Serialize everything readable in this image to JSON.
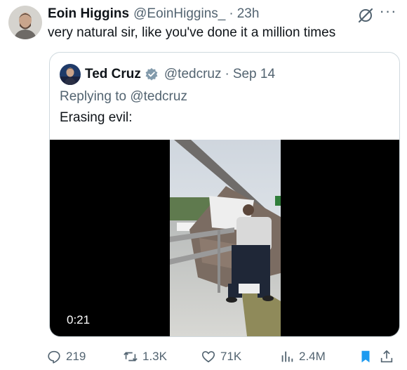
{
  "tweet": {
    "author_name": "Eoin Higgins",
    "author_handle": "@EoinHiggins_",
    "separator": "·",
    "time": "23h",
    "text": "very natural sir, like you've done it a million times",
    "more_glyph": "···"
  },
  "quoted_tweet": {
    "author_name": "Ted Cruz",
    "author_handle": "@tedcruz",
    "separator": "·",
    "date": "Sep 14",
    "replying_to_label": "Replying to",
    "replying_to_handle": "@tedcruz",
    "text": "Erasing evil:",
    "video": {
      "duration": "0:21"
    }
  },
  "actions": {
    "replies": "219",
    "retweets": "1.3K",
    "likes": "71K",
    "views": "2.4M"
  },
  "icons": {
    "grok": "grok-icon",
    "more": "more-icon",
    "verified": "verified-badge-icon",
    "reply": "reply-icon",
    "retweet": "retweet-icon",
    "like": "heart-icon",
    "views": "views-chart-icon",
    "bookmark": "bookmark-icon",
    "share": "share-icon"
  },
  "colors": {
    "text": "#0f1419",
    "muted": "#536471",
    "border": "#cfd9de",
    "bookmark": "#1d9bf0",
    "verified_badge": "#829aab"
  }
}
